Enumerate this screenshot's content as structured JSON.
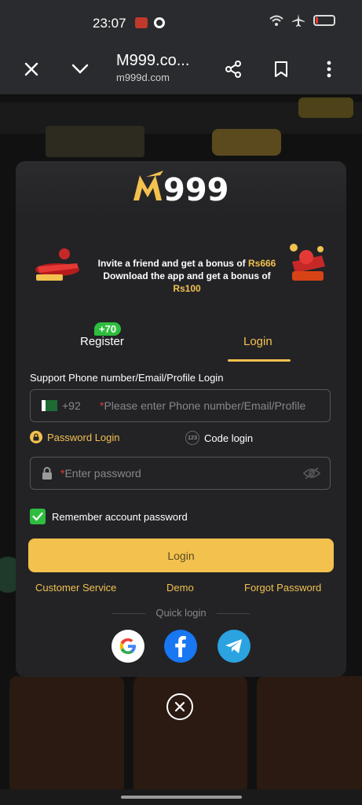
{
  "status_bar": {
    "time": "23:07"
  },
  "browser": {
    "title": "M999.co...",
    "url": "m999d.com"
  },
  "modal": {
    "brand": "M999",
    "promo": {
      "line1_text": "Invite a friend and get a bonus of ",
      "line1_amount": "Rs666",
      "line2_text": "Download the app and get a bonus of ",
      "line2_amount": "Rs100"
    },
    "tabs": {
      "register_label": "Register",
      "register_badge": "+70",
      "login_label": "Login"
    },
    "field_label": "Support Phone number/Email/Profile Login",
    "phone": {
      "country_code": "+92",
      "required_mark": "*",
      "placeholder": "Please enter Phone number/Email/Profile"
    },
    "modes": {
      "password": "Password Login",
      "code": "Code login",
      "code_badge": "123"
    },
    "password": {
      "required_mark": "*",
      "placeholder": "Enter password"
    },
    "remember_label": "Remember account password",
    "login_button": "Login",
    "links": {
      "customer_service": "Customer Service",
      "demo": "Demo",
      "forgot": "Forgot Password"
    },
    "quick_login": "Quick login"
  },
  "colors": {
    "accent": "#f2c14e",
    "badge_green": "#2ebd3e",
    "modal_bg": "#232326"
  }
}
